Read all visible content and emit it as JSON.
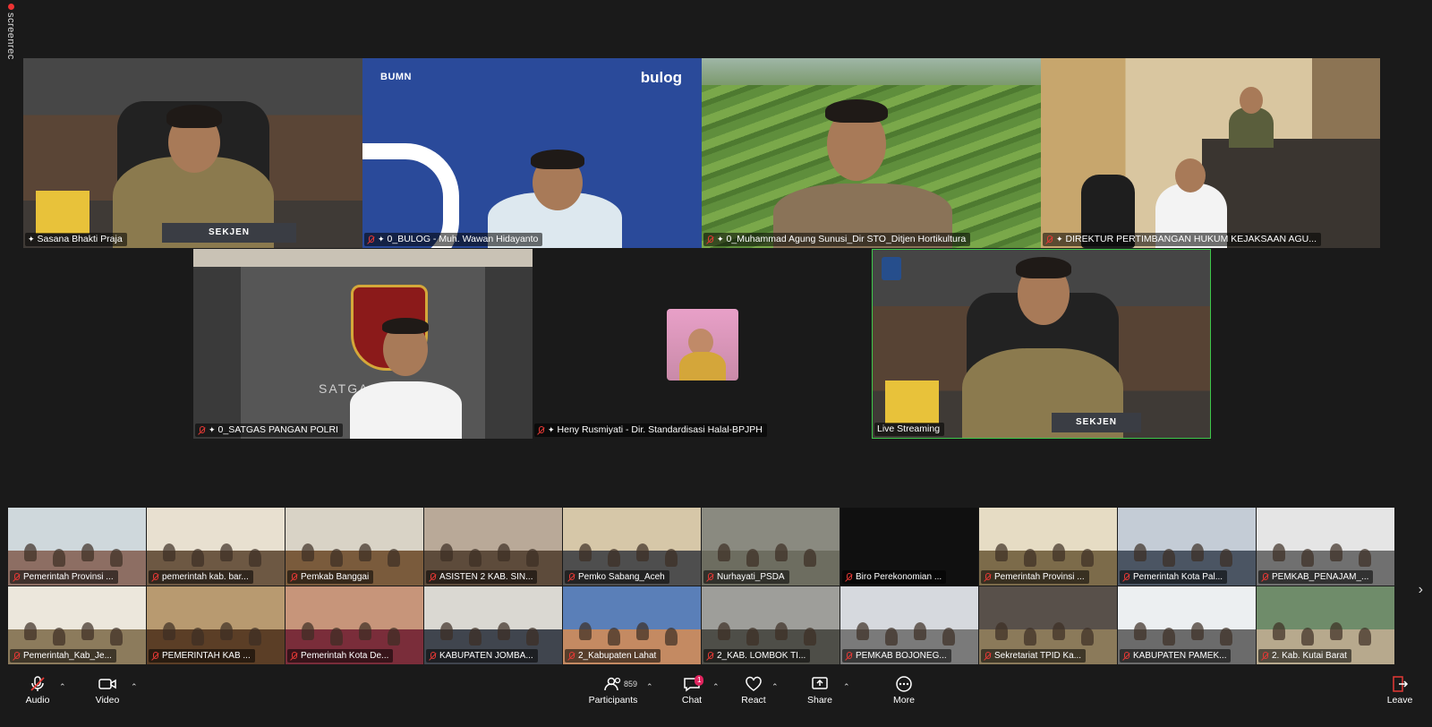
{
  "watermark": "screenrec",
  "speaker_tiles": [
    {
      "name": "Sasana Bhakti Praja",
      "muted": true,
      "pinned": true
    },
    {
      "name": "0_BULOG - Muh. Wawan Hidayanto",
      "muted": true,
      "pinned": true
    },
    {
      "name": "0_Muhammad Agung Sunusi_Dir STO_Ditjen Hortikultura",
      "muted": true,
      "pinned": true
    },
    {
      "name": "DIREKTUR PERTIMBANGAN HUKUM KEJAKSAAN AGU...",
      "muted": true,
      "pinned": true
    },
    {
      "name": "0_SATGAS PANGAN POLRI",
      "muted": true,
      "pinned": true
    },
    {
      "name": "Heny Rusmiyati - Dir. Standardisasi Halal-BPJPH",
      "muted": true,
      "pinned": true
    },
    {
      "name": "Live Streaming",
      "muted": false,
      "pinned": false,
      "active": true
    }
  ],
  "bulog_logo": "bulog",
  "bumn_logo": "BUMN",
  "sekjen_label": "SEKJEN",
  "satgas_wall": "SATGAS",
  "gallery_row1": [
    "Pemerintah Provinsi ...",
    "pemerintah kab. bar...",
    "Pemkab Banggai",
    "ASISTEN 2 KAB. SIN...",
    "Pemko Sabang_Aceh",
    "Nurhayati_PSDA",
    "Biro Perekonomian ...",
    "Pemerintah Provinsi ...",
    "Pemerintah Kota Pal...",
    "PEMKAB_PENAJAM_..."
  ],
  "gallery_row2": [
    "Pemerintah_Kab_Je...",
    "PEMERINTAH KAB ...",
    "Pemerintah Kota De...",
    "KABUPATEN JOMBA...",
    "2_Kabupaten Lahat",
    "2_KAB. LOMBOK TI...",
    "PEMKAB BOJONEG...",
    "Sekretariat TPID Ka...",
    "KABUPATEN PAMEK...",
    "2. Kab. Kutai Barat"
  ],
  "toolbar": {
    "audio": "Audio",
    "video": "Video",
    "participants": "Participants",
    "participants_count": "859",
    "chat": "Chat",
    "chat_badge": "1",
    "react": "React",
    "share": "Share",
    "more": "More",
    "leave": "Leave"
  },
  "colors": {
    "active_border": "#3ec74a",
    "toolbar_bg": "#1a1a1a",
    "leave_red": "#e53935"
  }
}
